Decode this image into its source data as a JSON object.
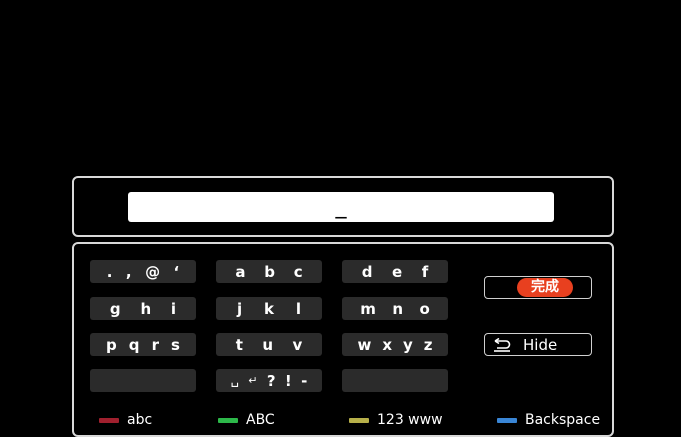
{
  "input": {
    "value": "_"
  },
  "keys": {
    "row1": [
      [
        ".",
        ",",
        "@",
        "‘"
      ],
      [
        "a",
        "b",
        "c"
      ],
      [
        "d",
        "e",
        "f"
      ]
    ],
    "row2": [
      [
        "g",
        "h",
        "i"
      ],
      [
        "j",
        "k",
        "l"
      ],
      [
        "m",
        "n",
        "o"
      ]
    ],
    "row3": [
      [
        "p",
        "q",
        "r",
        "s"
      ],
      [
        "t",
        "u",
        "v"
      ],
      [
        "w",
        "x",
        "y",
        "z"
      ]
    ],
    "row4_middle": [
      "␣",
      "↵",
      "?",
      "!",
      "-"
    ]
  },
  "buttons": {
    "done_label": "完成",
    "hide_label": "Hide"
  },
  "legend": [
    {
      "label": "abc",
      "color": "#a0202e"
    },
    {
      "label": "ABC",
      "color": "#2db84a"
    },
    {
      "label": "123 www",
      "color": "#b7b04a"
    },
    {
      "label": "Backspace",
      "color": "#3a86d6"
    }
  ],
  "colors": {
    "accent": "#e8401f",
    "key_bg": "#2b2b2b"
  }
}
